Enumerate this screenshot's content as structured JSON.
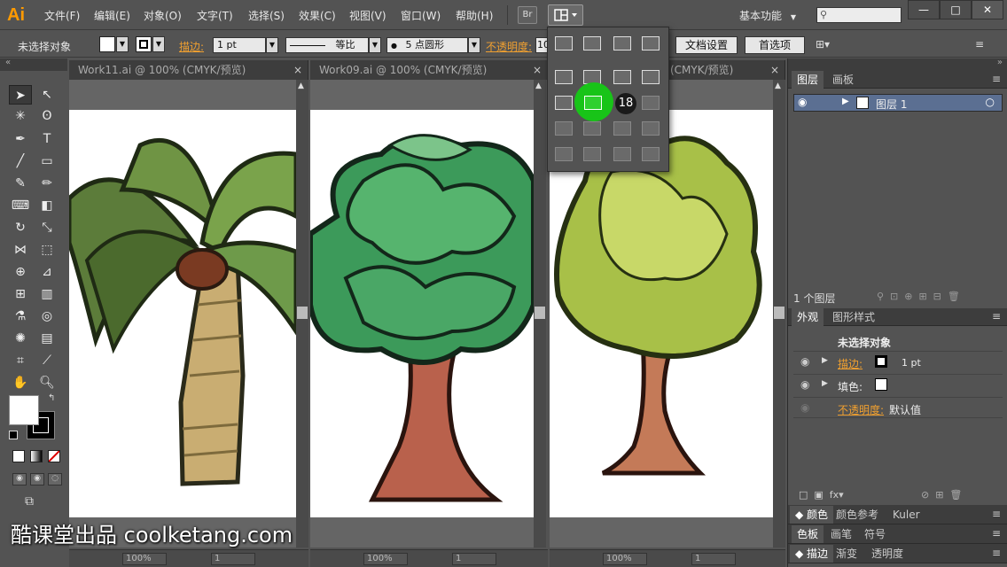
{
  "app": {
    "logo": "Ai"
  },
  "menu": [
    "文件(F)",
    "编辑(E)",
    "对象(O)",
    "文字(T)",
    "选择(S)",
    "效果(C)",
    "视图(V)",
    "窗口(W)",
    "帮助(H)"
  ],
  "bridge_label": "Br",
  "workspace_label": "基本功能",
  "window_buttons": [
    "—",
    "□",
    "✕"
  ],
  "controlbar": {
    "selection_label": "未选择对象",
    "stroke_label": "描边:",
    "stroke_weight": "1 pt",
    "stroke_profile": "等比",
    "brush": "5 点圆形",
    "opacity_label": "不透明度:",
    "opacity_value": "10",
    "doc_setup": "文档设置",
    "preferences": "首选项"
  },
  "tabs": [
    {
      "title": "Work11.ai @ 100% (CMYK/预览)"
    },
    {
      "title": "Work09.ai @ 100% (CMYK/预览)"
    },
    {
      "title": "(CMYK/预览)"
    }
  ],
  "status": {
    "zoom1": "100%",
    "page1": "1",
    "zoom2": "100%",
    "page2": "1",
    "zoom3": "100%",
    "page3": "1"
  },
  "popup": {
    "badge": "18",
    "highlight_color": "#18c418"
  },
  "layers": {
    "tab1": "图层",
    "tab2": "画板",
    "layer_name": "图层 1",
    "count": "1 个图层"
  },
  "appearance": {
    "tab1": "外观",
    "tab2": "图形样式",
    "title": "未选择对象",
    "stroke_label": "描边:",
    "stroke_value": "1 pt",
    "fill_label": "填色:",
    "opacity_label": "不透明度:",
    "opacity_value": "默认值"
  },
  "lower_tabs": [
    [
      "颜色",
      "颜色参考",
      "Kuler"
    ],
    [
      "色板",
      "画笔",
      "符号"
    ],
    [
      "描边",
      "渐变",
      "透明度"
    ]
  ],
  "watermark": "酷课堂出品 coolketang.com",
  "colors": {
    "accent": "#ff9a00",
    "panel": "#535353",
    "highlight": "#18c418"
  }
}
